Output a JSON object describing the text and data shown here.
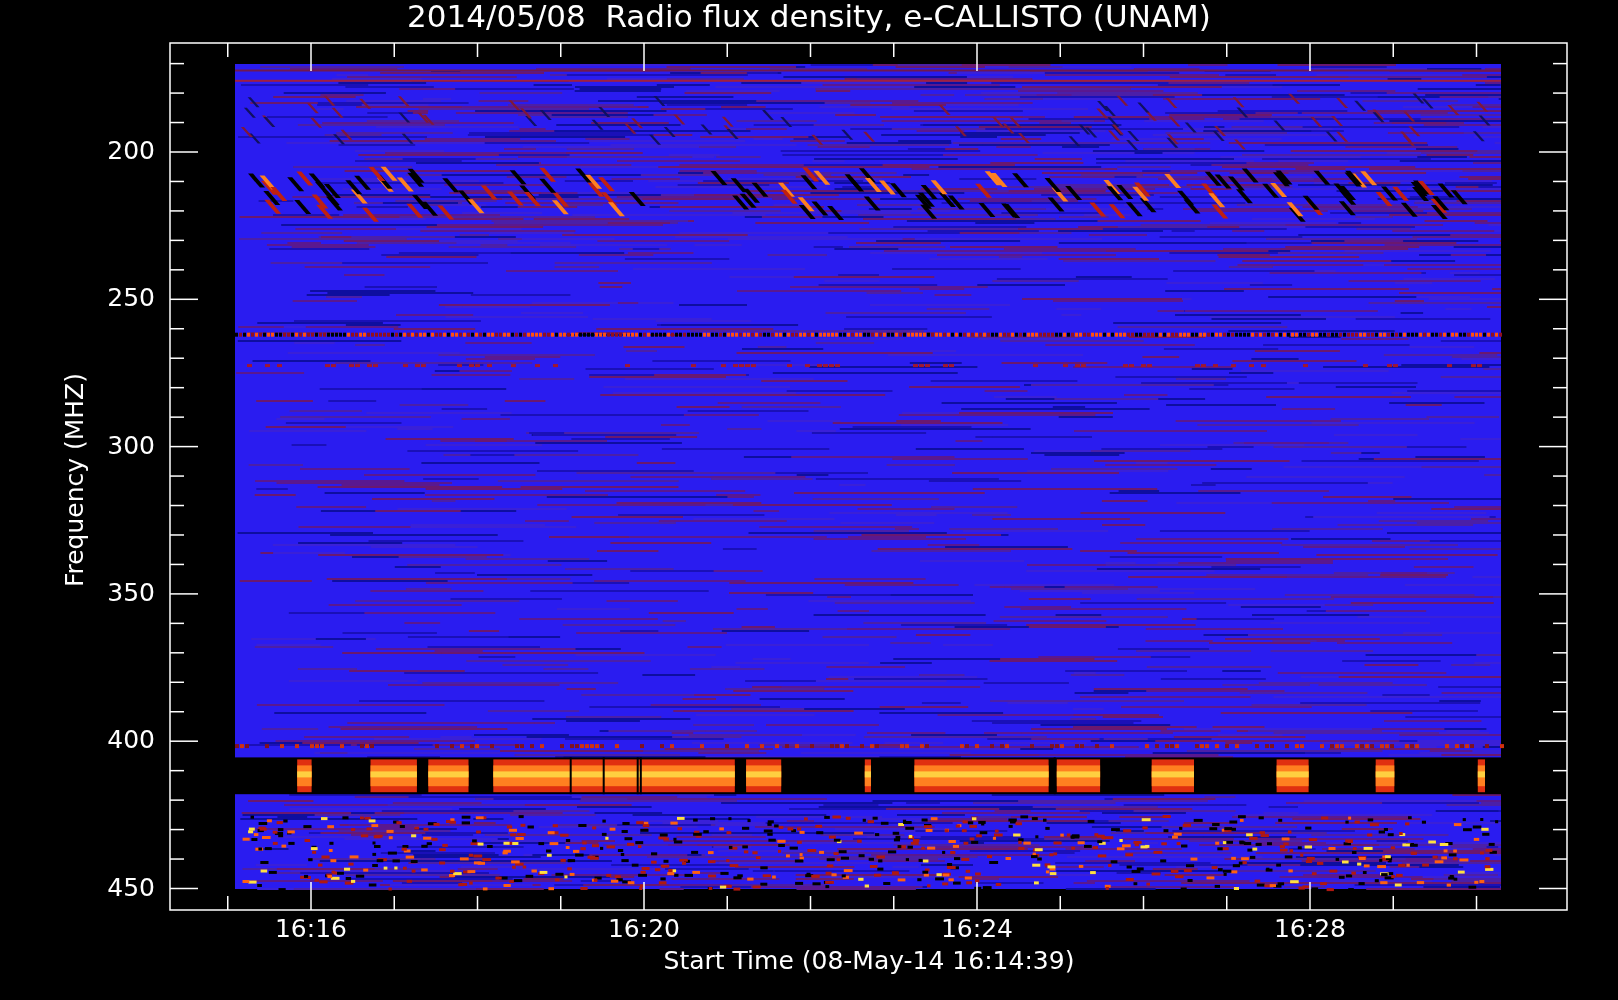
{
  "title": "2014/05/08  Radio flux density, e-CALLISTO (UNAM)",
  "y_axis": {
    "label": "Frequency (MHZ)",
    "ticks": [
      "200",
      "250",
      "300",
      "350",
      "400",
      "450"
    ]
  },
  "x_axis": {
    "label": "Start Time (08-May-14 16:14:39)",
    "ticks": [
      "16:16",
      "16:20",
      "16:24",
      "16:28"
    ]
  }
}
